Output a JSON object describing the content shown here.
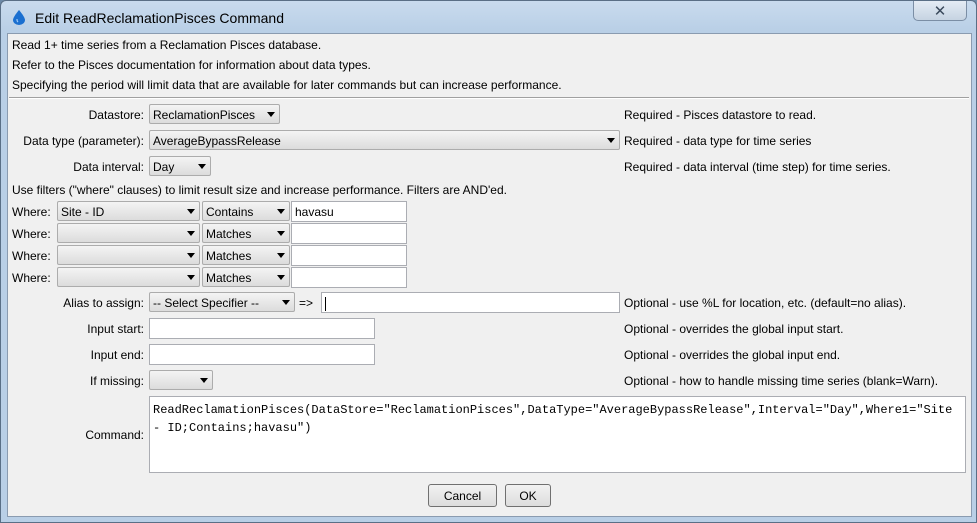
{
  "window": {
    "title": "Edit ReadReclamationPisces Command",
    "close_glyph": "✕",
    "app_icon": "water-drop-icon",
    "accent_color": "#1a6fd0"
  },
  "intro": {
    "line1": "Read 1+ time series from a Reclamation Pisces database.",
    "line2": "Refer to the Pisces documentation for information about data types.",
    "line3": "Specifying the period will limit data that are available for later commands but can increase performance."
  },
  "datastore": {
    "label": "Datastore:",
    "value": "ReclamationPisces",
    "note": "Required - Pisces datastore to read."
  },
  "datatype": {
    "label": "Data type (parameter):",
    "value": "AverageBypassRelease",
    "note": "Required - data type for time series"
  },
  "interval": {
    "label": "Data interval:",
    "value": "Day",
    "note": "Required - data interval (time step) for time series."
  },
  "filters": {
    "heading": "Use filters (\"where\" clauses) to limit result size and increase performance.  Filters are AND'ed.",
    "rows": [
      {
        "label": "Where:",
        "field": "Site - ID",
        "operator": "Contains",
        "value": "havasu"
      },
      {
        "label": "Where:",
        "field": "",
        "operator": "Matches",
        "value": ""
      },
      {
        "label": "Where:",
        "field": "",
        "operator": "Matches",
        "value": ""
      },
      {
        "label": "Where:",
        "field": "",
        "operator": "Matches",
        "value": ""
      }
    ]
  },
  "alias": {
    "label": "Alias to assign:",
    "specifier": "-- Select Specifier --",
    "arrow": "=>",
    "value": "",
    "note": "Optional - use %L for location, etc. (default=no alias)."
  },
  "input_start": {
    "label": "Input start:",
    "value": "",
    "note": "Optional - overrides the global input start."
  },
  "input_end": {
    "label": "Input end:",
    "value": "",
    "note": "Optional - overrides the global input end."
  },
  "if_missing": {
    "label": "If missing:",
    "value": "",
    "note": "Optional - how to handle missing time series (blank=Warn)."
  },
  "command": {
    "label": "Command:",
    "text": "ReadReclamationPisces(DataStore=\"ReclamationPisces\",DataType=\"AverageBypassRelease\",Interval=\"Day\",Where1=\"Site - ID;Contains;havasu\")"
  },
  "buttons": {
    "cancel": "Cancel",
    "ok": "OK"
  }
}
